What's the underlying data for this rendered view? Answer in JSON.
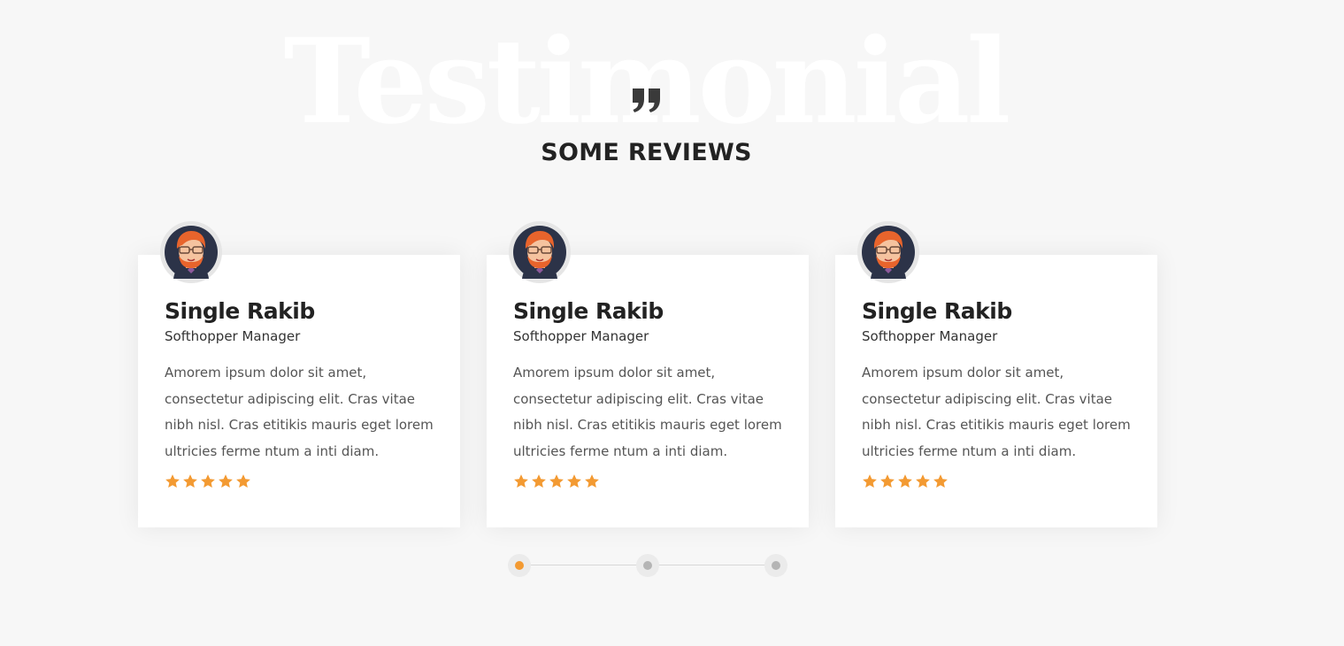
{
  "section": {
    "watermark": "Testimonial",
    "title": "SOME REVIEWS",
    "quote_icon": "quote-icon"
  },
  "colors": {
    "background": "#f7f7f7",
    "accent": "#f39a32",
    "dot_inactive": "#b5b5b5"
  },
  "testimonials": [
    {
      "name": "Single Rakib",
      "role": "Softhopper Manager",
      "text": "Amorem ipsum dolor sit amet, consectetur adipiscing elit. Cras vitae nibh nisl. Cras etitikis mauris eget lorem ultricies ferme ntum a inti diam.",
      "rating": 5,
      "rating_max": 5,
      "avatar_icon": "avatar-icon"
    },
    {
      "name": "Single Rakib",
      "role": "Softhopper Manager",
      "text": "Amorem ipsum dolor sit amet, consectetur adipiscing elit. Cras vitae nibh nisl. Cras etitikis mauris eget lorem ultricies ferme ntum a inti diam.",
      "rating": 5,
      "rating_max": 5,
      "avatar_icon": "avatar-icon"
    },
    {
      "name": "Single Rakib",
      "role": "Softhopper Manager",
      "text": "Amorem ipsum dolor sit amet, consectetur adipiscing elit. Cras vitae nibh nisl. Cras etitikis mauris eget lorem ultricies ferme ntum a inti diam.",
      "rating": 5,
      "rating_max": 5,
      "avatar_icon": "avatar-icon"
    }
  ],
  "pagination": {
    "count": 3,
    "active_index": 0
  }
}
